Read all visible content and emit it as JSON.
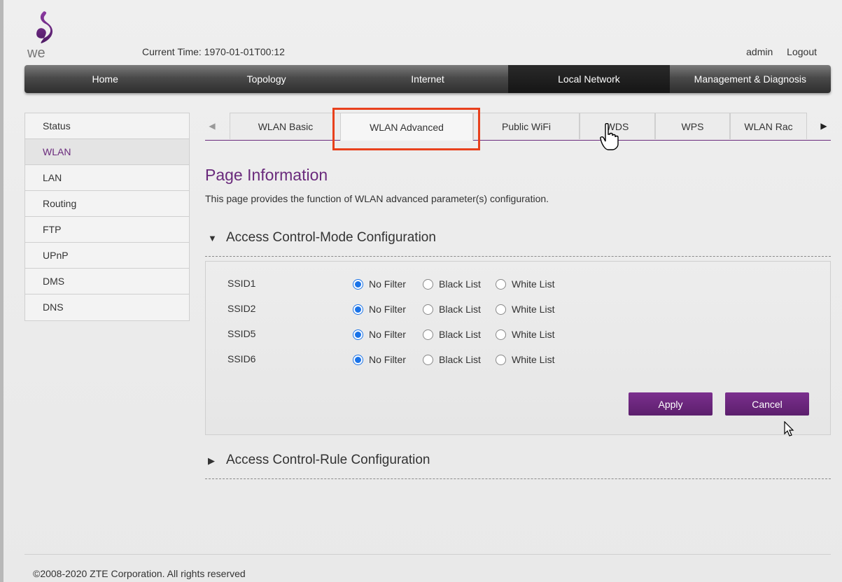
{
  "header": {
    "brand": "we",
    "current_time_label": "Current Time:",
    "current_time_value": "1970-01-01T00:12",
    "user": "admin",
    "logout": "Logout"
  },
  "nav": {
    "items": [
      {
        "label": "Home"
      },
      {
        "label": "Topology"
      },
      {
        "label": "Internet"
      },
      {
        "label": "Local Network",
        "active": true
      },
      {
        "label": "Management & Diagnosis"
      }
    ]
  },
  "sidebar": {
    "items": [
      {
        "label": "Status"
      },
      {
        "label": "WLAN",
        "active": true
      },
      {
        "label": "LAN"
      },
      {
        "label": "Routing"
      },
      {
        "label": "FTP"
      },
      {
        "label": "UPnP"
      },
      {
        "label": "DMS"
      },
      {
        "label": "DNS"
      }
    ]
  },
  "tabs": {
    "items": [
      {
        "label": "WLAN Basic"
      },
      {
        "label": "WLAN Advanced",
        "active": true
      },
      {
        "label": "Public WiFi"
      },
      {
        "label": "WDS"
      },
      {
        "label": "WPS"
      },
      {
        "label": "WLAN Rac"
      }
    ]
  },
  "page": {
    "title": "Page Information",
    "description": "This page provides the function of WLAN advanced parameter(s) configuration."
  },
  "section_mode": {
    "title": "Access Control-Mode Configuration",
    "options": [
      "No Filter",
      "Black List",
      "White List"
    ],
    "rows": [
      {
        "ssid": "SSID1",
        "selected": "No Filter"
      },
      {
        "ssid": "SSID2",
        "selected": "No Filter"
      },
      {
        "ssid": "SSID5",
        "selected": "No Filter"
      },
      {
        "ssid": "SSID6",
        "selected": "No Filter"
      }
    ],
    "apply": "Apply",
    "cancel": "Cancel"
  },
  "section_rule": {
    "title": "Access Control-Rule Configuration"
  },
  "footer": {
    "copyright": "©2008-2020 ZTE Corporation. All rights reserved"
  },
  "colors": {
    "accent": "#6a2a7c",
    "button": "#5c1f6d",
    "highlight": "#e8401c",
    "radio": "#1a73e8"
  }
}
